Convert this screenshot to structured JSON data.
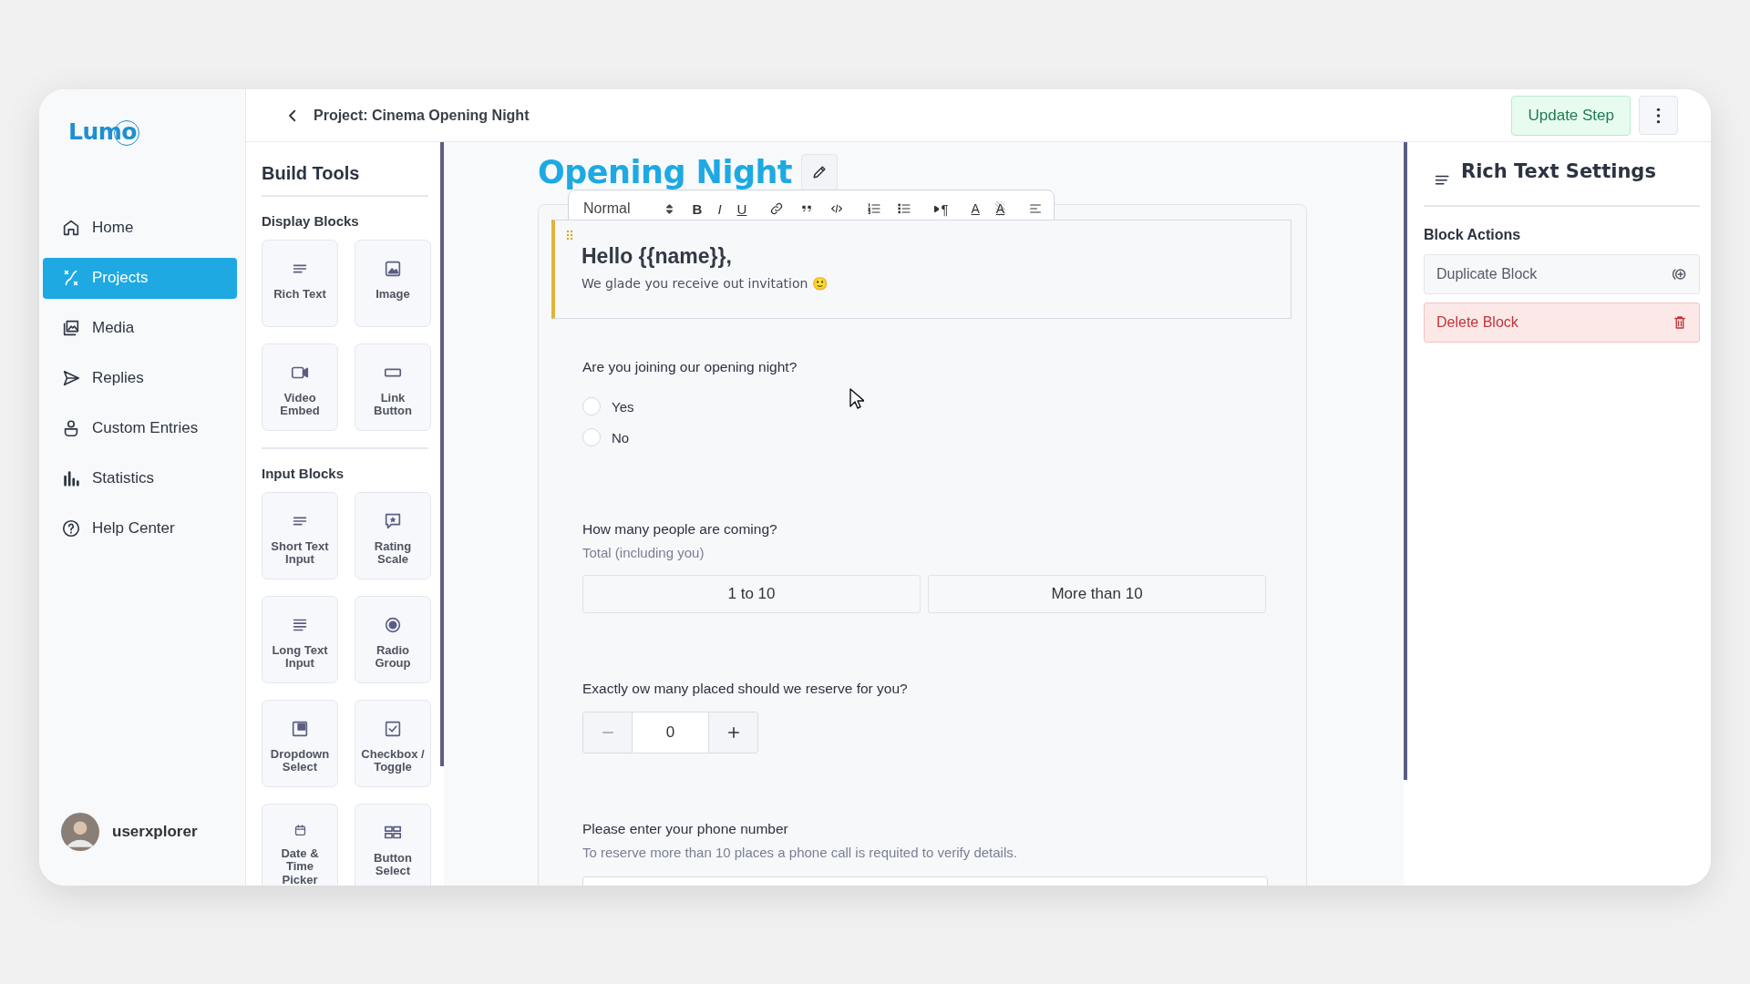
{
  "logo": "Lumo",
  "nav": [
    {
      "label": "Home",
      "selected": false
    },
    {
      "label": "Projects",
      "selected": true
    },
    {
      "label": "Media",
      "selected": false
    },
    {
      "label": "Replies",
      "selected": false
    },
    {
      "label": "Custom Entries",
      "selected": false
    },
    {
      "label": "Statistics",
      "selected": false
    },
    {
      "label": "Help Center",
      "selected": false
    }
  ],
  "user": {
    "name": "userxplorer"
  },
  "header": {
    "title": "Project: Cinema Opening Night",
    "primary_button": "Update Step"
  },
  "build_tools": {
    "title": "Build Tools",
    "groups": [
      {
        "title": "Display Blocks",
        "items": [
          "Rich Text",
          "Image",
          "Video Embed",
          "Link Button"
        ]
      },
      {
        "title": "Input Blocks",
        "items": [
          "Short Text Input",
          "Rating Scale",
          "Long Text Input",
          "Radio Group",
          "Dropdown Select",
          "Checkbox / Toggle",
          "Date & Time Picker",
          "Button Select"
        ]
      }
    ]
  },
  "form": {
    "title": "Opening Night",
    "toolbar": {
      "style": "Normal",
      "format_buttons": [
        "B",
        "I",
        "U"
      ],
      "direction_button": "¶",
      "color_buttons": [
        "A",
        "A"
      ]
    },
    "intro": {
      "heading": "Hello {{name}},",
      "body": "We glade you receive out invitation 🙂"
    },
    "blocks": [
      {
        "kind": "radio",
        "label": "Are you joining our opening night?",
        "options": [
          {
            "label": "Yes",
            "selected": false
          },
          {
            "label": "No",
            "selected": false
          }
        ]
      },
      {
        "kind": "choice",
        "label": "How many people are coming?",
        "hint": "Total (including you)",
        "options": [
          {
            "label": "1 to 10",
            "selected": false
          },
          {
            "label": "More than 10",
            "selected": false
          }
        ]
      },
      {
        "kind": "stepper",
        "label": "Exactly ow many placed should we reserve for you?",
        "value": "0"
      },
      {
        "kind": "text",
        "label": "Please enter your phone number",
        "hint": "To reserve more than 10 places a phone call is requited to verify details."
      }
    ]
  },
  "settings": {
    "title": "Rich Text Settings",
    "section": "Block Actions",
    "actions": [
      {
        "label": "Duplicate Block",
        "kind": "duplicate"
      },
      {
        "label": "Delete Block",
        "kind": "delete"
      }
    ]
  }
}
